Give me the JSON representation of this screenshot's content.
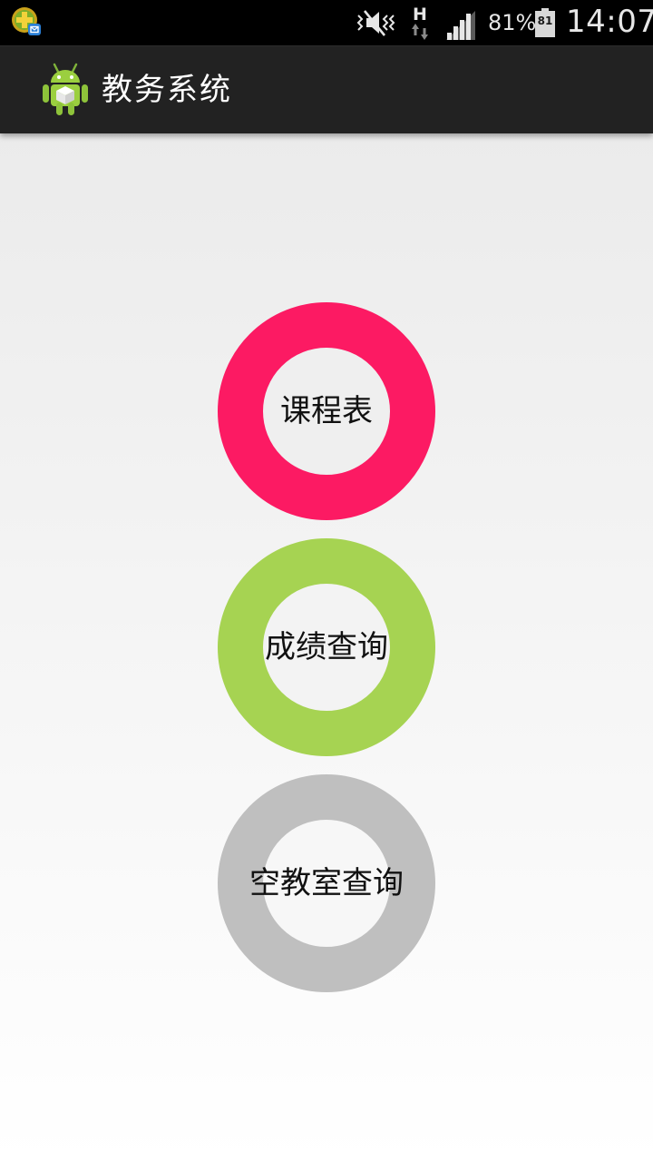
{
  "status_bar": {
    "notification_icon": "app-notification-icon",
    "mute_icon": "silent-mode-icon",
    "network_type": "H",
    "signal_icon": "signal-strength-icon",
    "battery_percent": "81%",
    "battery_level": "81",
    "battery_icon": "battery-icon",
    "time": "14:07"
  },
  "action_bar": {
    "app_icon": "android-app-icon",
    "title": "教务系统"
  },
  "menu": {
    "items": [
      {
        "label": "课程表",
        "color": "#fc1a63"
      },
      {
        "label": "成绩查询",
        "color": "#a6d352"
      },
      {
        "label": "空教室查询",
        "color": "#bfbfbf"
      }
    ]
  }
}
